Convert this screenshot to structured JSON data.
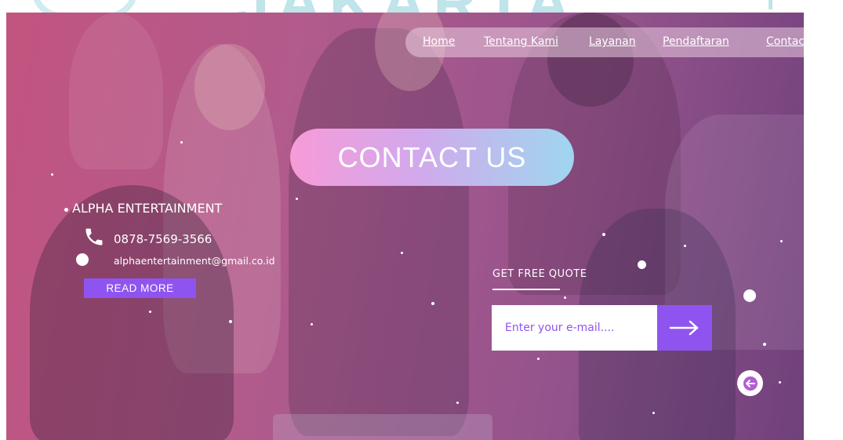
{
  "nav": {
    "items": [
      {
        "label": "Home"
      },
      {
        "label": "Tentang Kami"
      },
      {
        "label": "Layanan"
      },
      {
        "label": "Pendaftaran"
      },
      {
        "label": "Contact"
      }
    ]
  },
  "watermark": "JAKARTA",
  "hero": {
    "title": "CONTACT US"
  },
  "company": {
    "name": "ALPHA ENTERTAINMENT",
    "phone": "0878-7569-3566",
    "email": "alphaentertainment@gmail.co.id",
    "read_more_label": "READ MORE"
  },
  "quote": {
    "title": "GET FREE QUOTE",
    "email_placeholder": "Enter your e-mail...."
  },
  "icons": {
    "phone": "phone-icon",
    "submit": "arrow-right-icon",
    "back": "arrow-left-icon"
  },
  "colors": {
    "accent": "#8f54f0",
    "pill_start": "#f79bd8",
    "pill_end": "#9fd6ef",
    "overlay": "#a0376f"
  }
}
